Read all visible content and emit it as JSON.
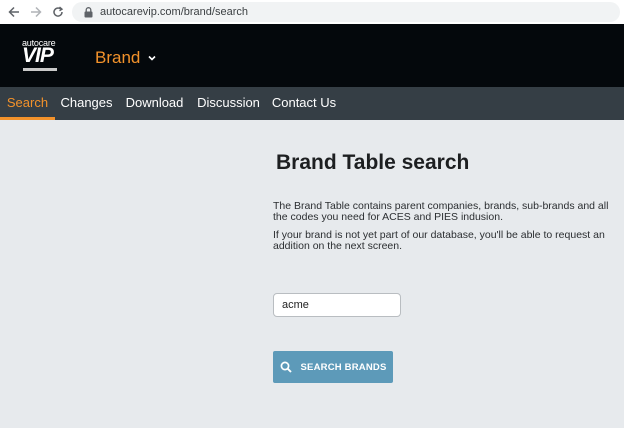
{
  "browser": {
    "url": "autocarevip.com/brand/search",
    "back_icon": "arrow-left-icon",
    "forward_icon": "arrow-right-icon",
    "reload_icon": "reload-icon",
    "lock_icon": "lock-icon"
  },
  "header": {
    "logo_top": "autocare",
    "logo_main": "VIP",
    "brand_menu_label": "Brand",
    "brand_menu_icon": "chevron-down-icon",
    "background": "#04080c",
    "accent": "#f3922b"
  },
  "nav": {
    "items": [
      {
        "label": "Search",
        "active": true
      },
      {
        "label": "Changes",
        "active": false
      },
      {
        "label": "Download",
        "active": false
      },
      {
        "label": "Discussion",
        "active": false
      },
      {
        "label": "Contact Us",
        "active": false
      }
    ],
    "background": "#353e45"
  },
  "main": {
    "title": "Brand Table search",
    "paragraph1": "The Brand Table contains parent companies, brands, sub-brands and all the codes you need for ACES and PIES indusion.",
    "paragraph2": "If your brand is not yet part of our database, you'll be able to request an addition on the next screen.",
    "search_value": "acme",
    "search_button_label": "SEARCH BRANDS",
    "search_button_icon": "search-icon",
    "button_color": "#5d9ab9"
  }
}
